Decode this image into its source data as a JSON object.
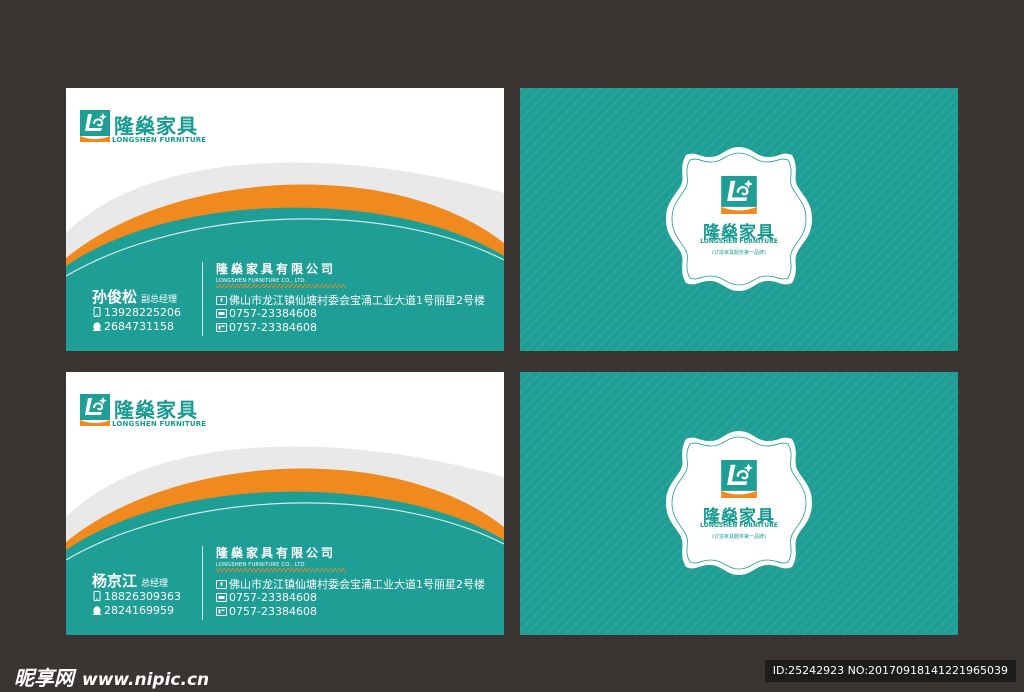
{
  "brand": {
    "name_cn": "隆燊家具",
    "name_en": "LONGSHEN FURNITURE",
    "slogan": "(订造家具服务第一品牌)",
    "colors": {
      "teal": "#1f9e95",
      "orange": "#f08a1f",
      "grey_wave": "#e6e6e6",
      "background": "#3a3432"
    }
  },
  "company": {
    "name_cn": "隆燊家具有限公司",
    "name_en": "LONGSHEN FURNITURE CO., LTD.",
    "address": "佛山市龙江镇仙塘村委会宝涌工业大道1号丽星2号楼",
    "tel": "0757-23384608",
    "fax": "0757-23384608"
  },
  "cards": [
    {
      "person_name": "孙俊松",
      "person_title": "副总经理",
      "mobile": "13928225206",
      "qq": "2684731158"
    },
    {
      "person_name": "杨京江",
      "person_title": "总经理",
      "mobile": "18826309363",
      "qq": "2824169959"
    }
  ],
  "icons": {
    "phone": "phone-icon",
    "qq": "qq-penguin-icon",
    "address": "location-icon",
    "tel": "telephone-icon",
    "fax": "fax-icon"
  },
  "watermark": {
    "site_cn": "昵享网",
    "url": "www.nipic.cn",
    "id_text": "ID:25242923 NO:20170918141221965039"
  }
}
